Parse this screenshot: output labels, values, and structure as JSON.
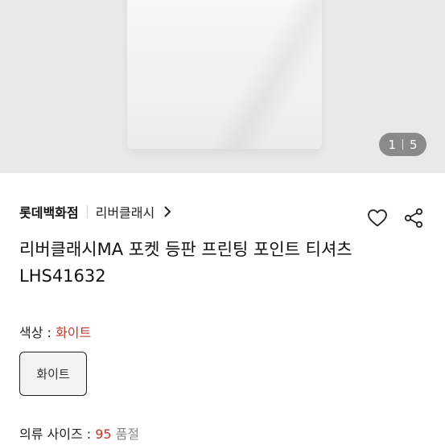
{
  "gallery": {
    "current": "1",
    "total": "5"
  },
  "brand": {
    "store": "롯데백화점",
    "name": "리버클래시"
  },
  "product": {
    "title": "리버클래시MA 포켓 등판 프린팅 포인트 티셔츠 LHS41632"
  },
  "color": {
    "label": "색상 : ",
    "selected": "화이트",
    "chip": "화이트"
  },
  "size": {
    "label": "의류 사이즈 : ",
    "value": "95",
    "unit": " 품절"
  },
  "icons": {
    "wishlist": "heart-icon",
    "share": "share-icon",
    "brand_link": "chevron-right-icon"
  },
  "colors": {
    "accent": "#c0392b",
    "counter_bg": "#8a8a8a"
  }
}
